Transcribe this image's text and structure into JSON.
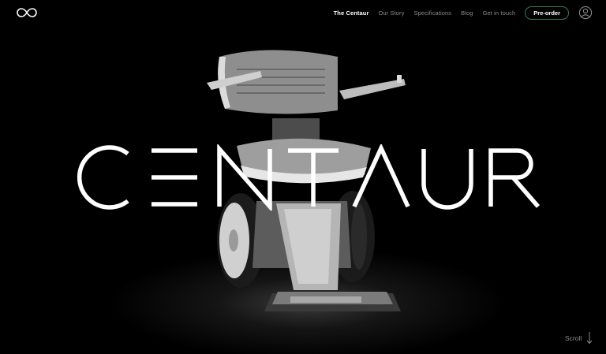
{
  "brand": {
    "logo_icon": "infinity-logo-icon",
    "wordmark": "CENTAUR"
  },
  "nav": {
    "items": [
      {
        "label": "The Centaur",
        "active": true
      },
      {
        "label": "Our Story",
        "active": false
      },
      {
        "label": "Specifications",
        "active": false
      },
      {
        "label": "Blog",
        "active": false
      },
      {
        "label": "Get in touch",
        "active": false
      }
    ],
    "cta_label": "Pre-order",
    "account_icon": "user-icon"
  },
  "hero": {
    "scroll_label": "Scroll",
    "scroll_icon": "arrow-down-icon"
  },
  "colors": {
    "background": "#000000",
    "accent": "#2f7d4f",
    "text_muted": "#8a8a8a",
    "text": "#ffffff"
  }
}
